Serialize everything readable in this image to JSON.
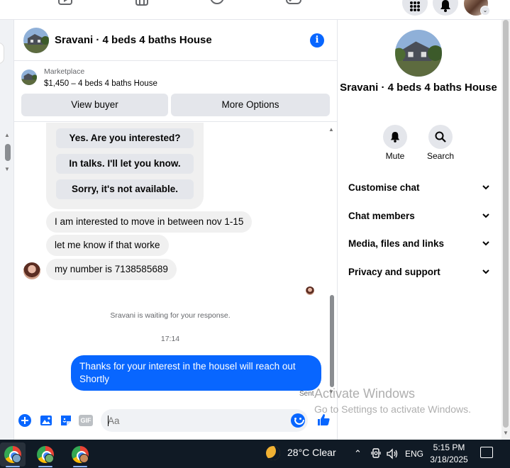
{
  "conversation": {
    "title": "Sravani · 4 beds 4 baths House"
  },
  "listing": {
    "source": "Marketplace",
    "summary": "$1,450 – 4 beds 4 baths House",
    "view_buyer_label": "View buyer",
    "more_options_label": "More Options"
  },
  "quick_replies": [
    "Yes. Are you interested?",
    "In talks. I'll let you know.",
    "Sorry, it's not available."
  ],
  "messages": [
    {
      "from": "them",
      "text": "I am interested to move in between nov 1-15"
    },
    {
      "from": "them",
      "text": "let me know if that worke"
    },
    {
      "from": "them",
      "text": "my number is 7138585689"
    },
    {
      "from": "me",
      "text": "Thanks for your interest in the housel will reach out Shortly"
    }
  ],
  "system_note": "Sravani is waiting for your response.",
  "timestamp": "17:14",
  "sent_label": "Sent",
  "composer": {
    "placeholder": "Aa"
  },
  "details": {
    "title": "Sravani · 4 beds 4 baths House",
    "actions": [
      {
        "label": "Mute",
        "icon": "bell-icon"
      },
      {
        "label": "Search",
        "icon": "search-icon"
      }
    ],
    "sections": [
      "Customise chat",
      "Chat members",
      "Media, files and links",
      "Privacy and support"
    ]
  },
  "watermark": {
    "line1": "Activate Windows",
    "line2": "Go to Settings to activate Windows."
  },
  "taskbar": {
    "weather": "28°C  Clear",
    "language": "ENG",
    "time": "5:15 PM",
    "date": "3/18/2025"
  },
  "colors": {
    "accent": "#0866ff",
    "bubble_in": "#f0f0f0",
    "button_bg": "#e4e6eb",
    "taskbar": "#101a25"
  }
}
